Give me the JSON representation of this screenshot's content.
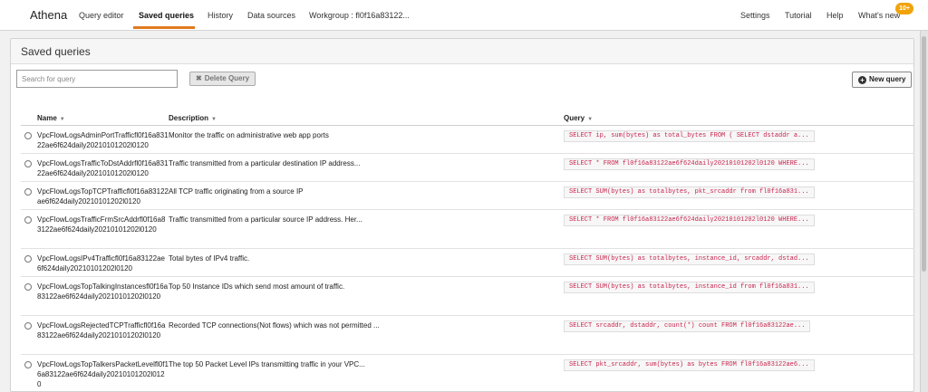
{
  "nav": {
    "brand": "Athena",
    "links": [
      "Query editor",
      "Saved queries",
      "History",
      "Data sources",
      "Workgroup : fl0f16a83122..."
    ],
    "right_links": [
      "Settings",
      "Tutorial",
      "Help",
      "What's new"
    ],
    "badge": "10+",
    "accent_color": "#e07a1f"
  },
  "panel": {
    "title": "Saved queries",
    "search_placeholder": "Search for query",
    "delete_label": "Delete Query",
    "new_label": "New query"
  },
  "table": {
    "columns": [
      "Name",
      "Description",
      "Query"
    ],
    "rows": [
      {
        "name": "VpcFlowLogsAdminPortTrafficfl0f16a83122ae6f624daily20210101202l0120",
        "description": "Monitor the traffic on administrative web app ports",
        "query": "SELECT ip, sum(bytes) as total_bytes FROM ( SELECT dstaddr a..."
      },
      {
        "name": "VpcFlowLogsTrafficToDstAddrfl0f16a83122ae6f624daily20210101202l0120",
        "description": "Traffic transmitted from a particular destination IP address...",
        "query": "SELECT * FROM fl0f16a83122ae6f624daily20210101202l0120 WHERE..."
      },
      {
        "name": "VpcFlowLogsTopTCPTrafficfl0f16a83122ae6f624daily20210101202l0120",
        "description": "All TCP traffic originating from a source IP",
        "query": "SELECT SUM(bytes) as totalbytes, pkt_srcaddr from fl0f16a831..."
      },
      {
        "name": "VpcFlowLogsTrafficFrmSrcAddrfl0f16a83122ae6f624daily20210101202l0120",
        "description": "Traffic transmitted from a particular source IP address. Her...",
        "query": "SELECT * FROM fl0f16a83122ae6f624daily20210101202l0120 WHERE..."
      },
      {
        "name": "VpcFlowLogsIPv4Trafficfl0f16a83122ae6f624daily20210101202l0120",
        "description": "Total bytes of IPv4 traffic.",
        "query": "SELECT SUM(bytes) as totalbytes, instance_id, srcaddr, dstad..."
      },
      {
        "name": "VpcFlowLogsTopTalkingInstancesfl0f16a83122ae6f624daily20210101202l0120",
        "description": "Top 50 Instance IDs which send most amount of traffic.",
        "query": "SELECT SUM(bytes) as totalbytes, instance_id from fl0f16a831..."
      },
      {
        "name": "VpcFlowLogsRejectedTCPTrafficfl0f16a83122ae6f624daily20210101202l0120",
        "description": "Recorded TCP connections(Not flows) which was not permitted ...",
        "query": "SELECT srcaddr, dstaddr, count(*) count FROM fl0f16a83122ae..."
      },
      {
        "name": "VpcFlowLogsTopTalkersPacketLevelfl0f16a83122ae6f624daily20210101202l0120",
        "description": "The top 50 Packet Level IPs transmitting traffic in your VPC...",
        "query": "SELECT pkt_srcaddr, sum(bytes) as bytes FROM fl0f16a83122ae6..."
      }
    ]
  }
}
